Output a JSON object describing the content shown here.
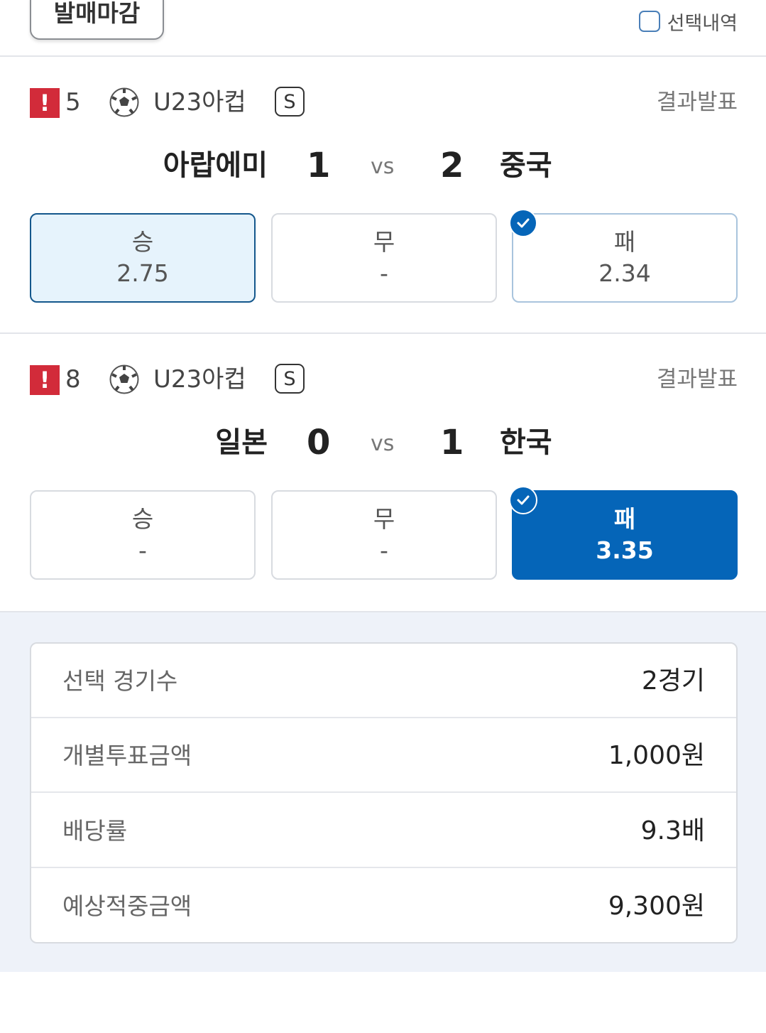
{
  "topbar": {
    "closed_badge": "발매마감",
    "selection_history_label": "선택내역"
  },
  "matches": [
    {
      "game_no": "5",
      "league": "U23아컵",
      "s_badge": "S",
      "status": "결과발표",
      "home_team": "아랍에미",
      "home_score": "1",
      "vs": "vs",
      "away_score": "2",
      "away_team": "중국",
      "odds": [
        {
          "label": "승",
          "value": "2.75"
        },
        {
          "label": "무",
          "value": "-"
        },
        {
          "label": "패",
          "value": "2.34"
        }
      ]
    },
    {
      "game_no": "8",
      "league": "U23아컵",
      "s_badge": "S",
      "status": "결과발표",
      "home_team": "일본",
      "home_score": "0",
      "vs": "vs",
      "away_score": "1",
      "away_team": "한국",
      "odds": [
        {
          "label": "승",
          "value": "-"
        },
        {
          "label": "무",
          "value": "-"
        },
        {
          "label": "패",
          "value": "3.35"
        }
      ]
    }
  ],
  "summary": [
    {
      "label": "선택 경기수",
      "value": "2경기"
    },
    {
      "label": "개별투표금액",
      "value": "1,000원"
    },
    {
      "label": "배당률",
      "value": "9.3배"
    },
    {
      "label": "예상적중금액",
      "value": "9,300원"
    }
  ],
  "colors": {
    "primary": "#0565b8",
    "alert": "#d22b3a",
    "light_selected_bg": "#e6f3fc",
    "summary_bg": "#eef2f9"
  }
}
